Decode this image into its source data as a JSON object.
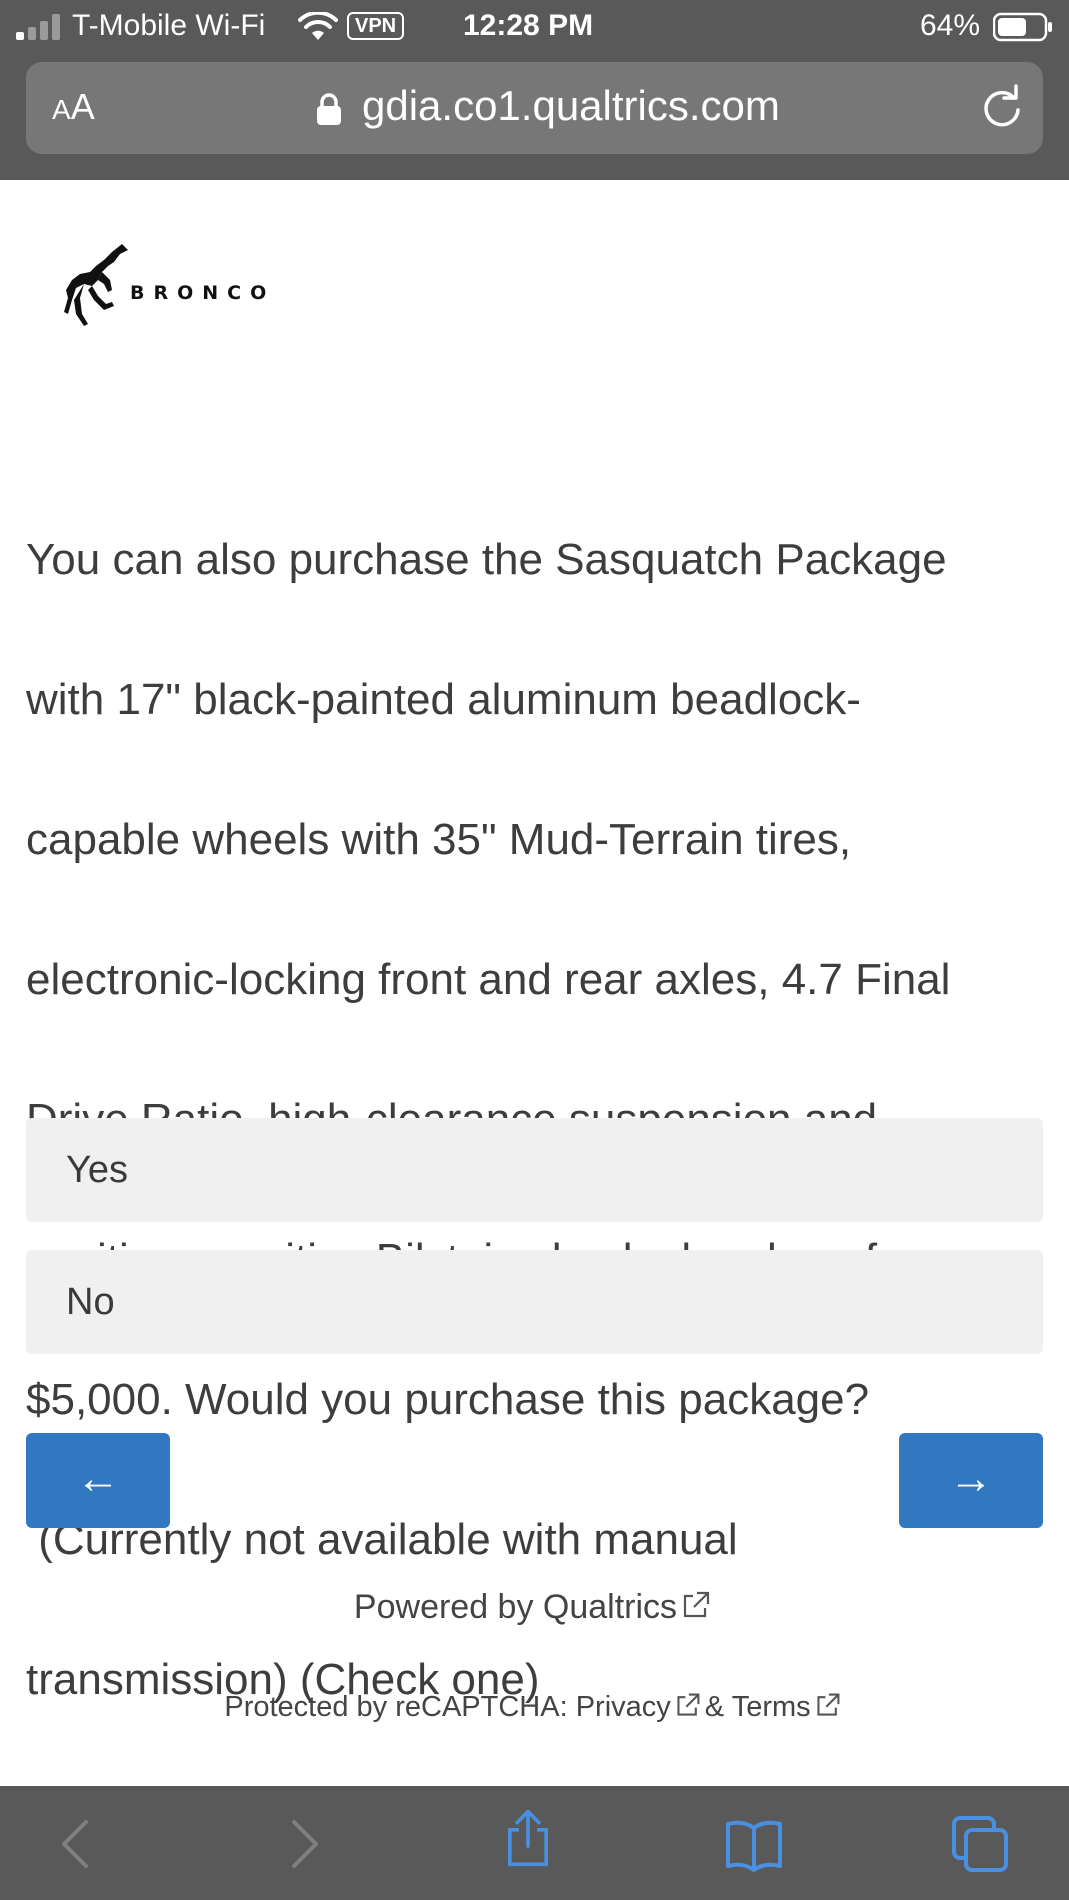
{
  "status_bar": {
    "carrier": "T-Mobile Wi-Fi",
    "vpn": "VPN",
    "time": "12:28 PM",
    "battery_percent": "64%",
    "battery_level": 0.64,
    "signal_bars_active": 1,
    "signal_bars_total": 4
  },
  "browser": {
    "text_size_button": {
      "small": "A",
      "large": "A"
    },
    "url": "gdia.co1.qualtrics.com"
  },
  "logo": {
    "text": "BRONCO"
  },
  "question": {
    "text": "You can also purchase the Sasquatch Package with 17\" black-painted aluminum beadlock-capable wheels with 35\" Mud-Terrain tires, electronic-locking front and rear axles, 4.7 Final Drive Ratio, high-clearance suspension and position-sensitive Bilstein shock absorbers for $5,000.  Would you purchase this package?  (Currently not available with manual transmission) (Check one)",
    "lines": [
      "You can also purchase the Sasquatch Package",
      "with 17\" black-painted aluminum beadlock-",
      "capable wheels with 35\" Mud-Terrain tires,",
      "electronic-locking front and rear axles, 4.7 Final",
      "Drive Ratio, high-clearance suspension and",
      "position-sensitive Bilstein shock absorbers for",
      "$5,000.  Would you purchase this package?",
      " (Currently not available with manual",
      "transmission) (Check one)"
    ]
  },
  "choices": [
    {
      "label": "Yes"
    },
    {
      "label": "No"
    }
  ],
  "navigation": {
    "back_label": "←",
    "next_label": "→"
  },
  "footer": {
    "powered_by": "Powered by Qualtrics",
    "recaptcha_prefix": "Protected by reCAPTCHA:",
    "privacy": "Privacy",
    "ampersand": "&",
    "terms": "Terms"
  },
  "colors": {
    "chrome": "#595959",
    "address_bar": "#777777",
    "button_blue": "#3178c0",
    "choice_bg": "#f0f0f0",
    "toolbar_icon_active": "#4a90e2",
    "toolbar_icon_disabled": "#7f7f7f"
  },
  "icons": [
    "wifi-icon",
    "lock-icon",
    "reload-icon",
    "external-link-icon",
    "back-icon",
    "forward-icon",
    "share-icon",
    "bookmarks-icon",
    "tabs-icon"
  ]
}
